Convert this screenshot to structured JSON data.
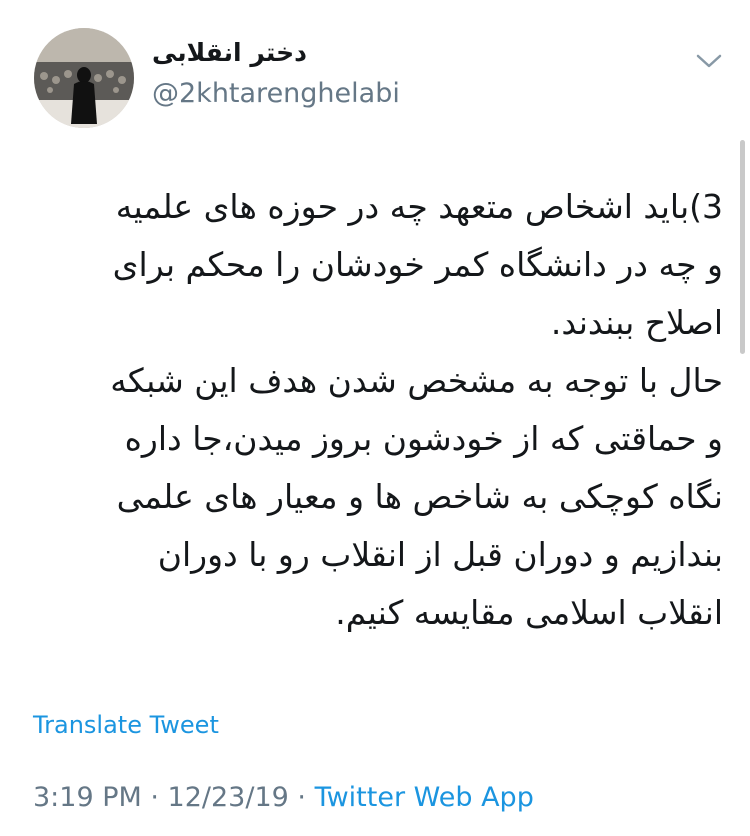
{
  "user": {
    "display_name": "دختر انقلابی",
    "handle": "@2khtarenghelabi"
  },
  "tweet": {
    "lines": [
      "3)باید اشخاص متعهد چه در حوزه های علمیه",
      "و چه در دانشگاه کمر خودشان را محکم برای",
      "اصلاح ببندند.",
      "حال با توجه به مشخص شدن هدف این شبکه",
      "و حماقتی که از خودشون بروز میدن،جا داره",
      "نگاه کوچکی به شاخص ها و معیار های علمی",
      "بندازیم و دوران قبل از انقلاب رو با دوران",
      "انقلاب اسلامی مقایسه کنیم."
    ]
  },
  "actions": {
    "translate_label": "Translate Tweet"
  },
  "meta": {
    "time": "3:19 PM",
    "separator": " · ",
    "date": "12/23/19",
    "source": "Twitter Web App"
  },
  "colors": {
    "link": "#1b95e0",
    "secondary_text": "#657786",
    "primary_text": "#14171a"
  },
  "icons": {
    "menu": "chevron-down-icon"
  }
}
